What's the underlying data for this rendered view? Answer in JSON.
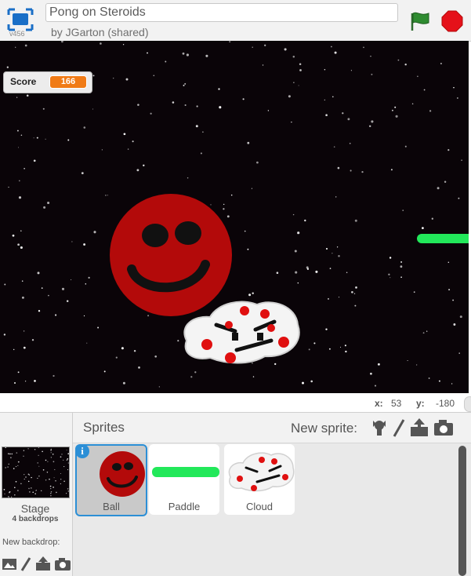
{
  "project": {
    "version": "v456",
    "title": "Pong on Steroids",
    "byline": "by JGarton (shared)"
  },
  "stage": {
    "monitor": {
      "label": "Score",
      "value": "166"
    },
    "mouse_x_label": "x:",
    "mouse_x": "53",
    "mouse_y_label": "y:",
    "mouse_y": "-180"
  },
  "sprites_pane": {
    "title": "Sprites",
    "new_sprite_label": "New sprite:",
    "new_sprite_icons": [
      "library-icon",
      "paint-icon",
      "upload-icon",
      "camera-icon"
    ],
    "stage_label": "Stage",
    "stage_backdrops": "4 backdrops",
    "new_backdrop_label": "New backdrop:",
    "new_backdrop_icons": [
      "backdrop-library-icon",
      "paint-icon",
      "upload-icon",
      "camera-icon"
    ],
    "sprites": [
      {
        "name": "Ball",
        "selected": true
      },
      {
        "name": "Paddle",
        "selected": false
      },
      {
        "name": "Cloud",
        "selected": false
      }
    ],
    "info_badge": "i"
  },
  "colors": {
    "accent_blue": "#2c8fd6",
    "ball_red": "#b30a0a",
    "paddle_green": "#22e85a",
    "stop_red": "#e5111a",
    "flag_green": "#2e8b30",
    "monitor_orange": "#f07b16"
  }
}
